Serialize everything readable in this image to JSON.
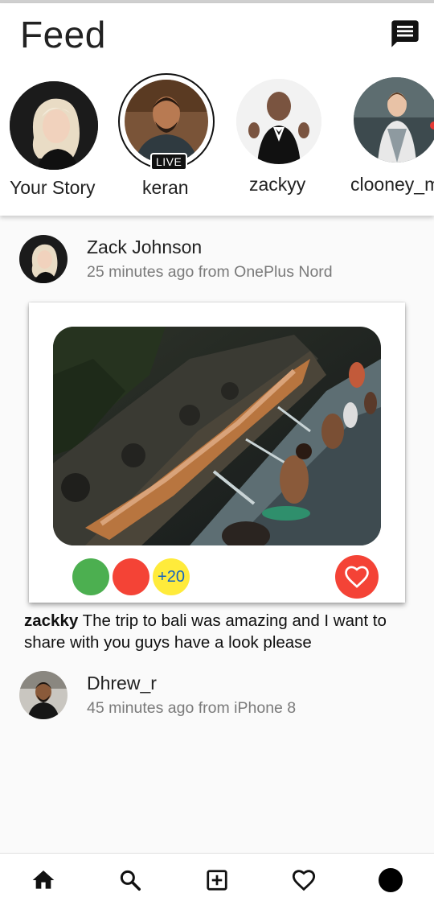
{
  "header": {
    "title": "Feed",
    "message_icon": "message-icon"
  },
  "stories": [
    {
      "label": "Your Story",
      "avatar": "avatar-blonde-woman",
      "live": false
    },
    {
      "label": "keran",
      "avatar": "avatar-man-beard",
      "live": true,
      "live_label": "LIVE"
    },
    {
      "label": "zackyy",
      "avatar": "avatar-bald-man-thumbs-up",
      "live": false
    },
    {
      "label": "clooney_m",
      "avatar": "avatar-chef-woman",
      "live": false
    }
  ],
  "posts": [
    {
      "user": "Zack Johnson",
      "meta": "25 minutes ago from OnePlus Nord",
      "image": "bali-water-temple-photo",
      "likes_extra": "+20",
      "liker_colors": [
        "#4caf50",
        "#f44336"
      ],
      "caption_user": "zackky",
      "caption_text": " The trip to bali was amazing and I want to share with you guys have a look please"
    },
    {
      "user": "Dhrew_r",
      "meta": "45 minutes ago from iPhone 8"
    }
  ],
  "nav": [
    {
      "icon": "home-icon"
    },
    {
      "icon": "search-icon"
    },
    {
      "icon": "add-post-icon"
    },
    {
      "icon": "heart-icon"
    },
    {
      "icon": "profile-icon"
    }
  ],
  "colors": {
    "accent_red": "#f44336",
    "green": "#4caf50",
    "yellow": "#ffeb3b",
    "count_blue": "#1565c0"
  }
}
